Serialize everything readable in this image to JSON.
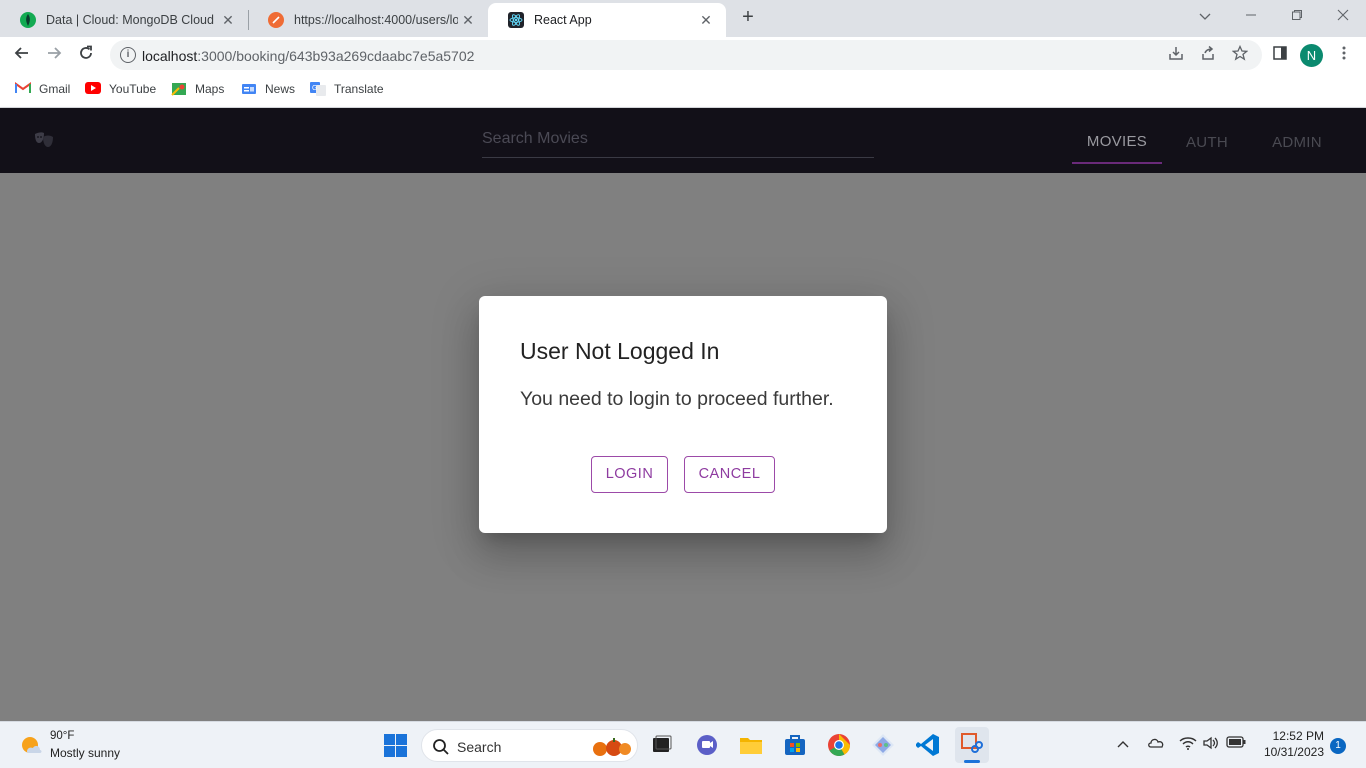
{
  "browser": {
    "tabs": [
      {
        "title": "Data | Cloud: MongoDB Cloud",
        "close": "✕"
      },
      {
        "title": "https://localhost:4000/users/log",
        "close": "✕"
      },
      {
        "title": "React App",
        "close": "✕"
      }
    ],
    "new_tab": "+",
    "url_host": "localhost",
    "url_path": ":3000/booking/643b93a269cdaabc7e5a5702",
    "profile_initial": "N",
    "bookmarks": [
      "Gmail",
      "YouTube",
      "Maps",
      "News",
      "Translate"
    ]
  },
  "app": {
    "search_placeholder": "Search Movies",
    "nav": {
      "movies": "MOVIES",
      "auth": "AUTH",
      "admin": "ADMIN"
    },
    "active_tab": "MOVIES"
  },
  "dialog": {
    "title": "User Not Logged In",
    "message": "You need to login to proceed further.",
    "login_label": "LOGIN",
    "cancel_label": "CANCEL"
  },
  "taskbar": {
    "weather_temp": "90°F",
    "weather_desc": "Mostly sunny",
    "search_label": "Search",
    "time": "12:52 PM",
    "date": "10/31/2023",
    "notification_count": "1"
  },
  "colors": {
    "accent": "#8e3ba0",
    "appbar": "#121018",
    "overlay": "#808080"
  }
}
